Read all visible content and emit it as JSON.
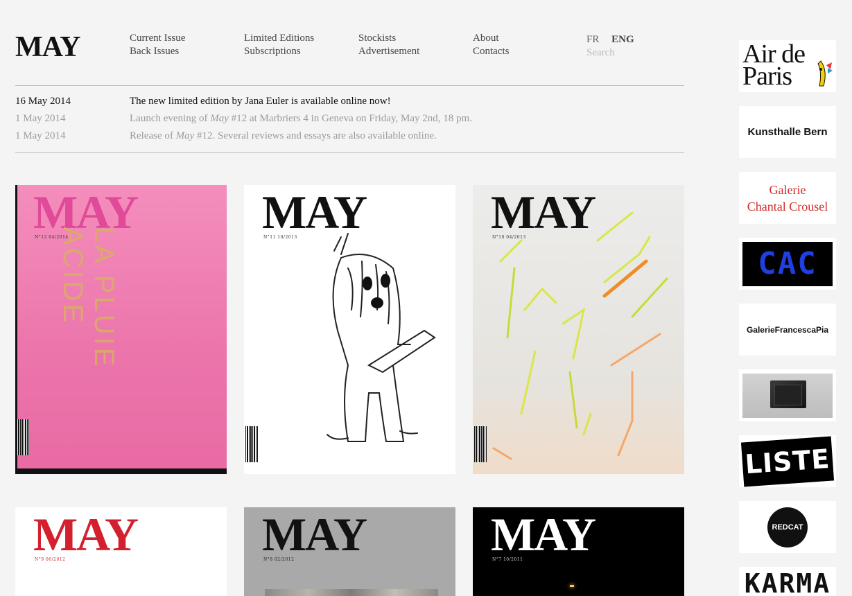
{
  "brand": {
    "logo": "MAY"
  },
  "nav": {
    "col1": [
      "Current Issue",
      "Back Issues"
    ],
    "col2": [
      "Limited Editions",
      "Subscriptions"
    ],
    "col3": [
      "Stockists",
      "Advertisement"
    ],
    "col4": [
      "About",
      "Contacts"
    ]
  },
  "lang": {
    "fr": "FR",
    "eng": "ENG"
  },
  "search": {
    "placeholder": "Search"
  },
  "news": [
    {
      "date": "16 May 2014",
      "text": "The new limited edition by Jana Euler is available online now!"
    },
    {
      "date": "1 May 2014",
      "text_before": "Launch evening of ",
      "text_em": "May",
      "text_after": " #12 at Marbriers 4 in Geneva on Friday, May 2nd, 18 pm."
    },
    {
      "date": "1 May 2014",
      "text_before": "Release of ",
      "text_em": "May",
      "text_after": " #12. Several reviews and essays are also available online."
    }
  ],
  "covers": [
    {
      "title": "MAY",
      "number": "N°12  04/2014",
      "cover_text": "LA PLUIE ACIDE",
      "bg": "#ef7fb2",
      "title_color": "#e04a98"
    },
    {
      "title": "MAY",
      "number": "N°11  10/2013",
      "bg": "#ffffff",
      "title_color": "#111111"
    },
    {
      "title": "MAY",
      "number": "N°10  04/2013",
      "bg": "#e8e6e2",
      "title_color": "#111111"
    },
    {
      "title": "MAY",
      "number": "N°9  06/2012",
      "bg": "#ffffff",
      "title_color": "#d4202e"
    },
    {
      "title": "MAY",
      "number": "N°8  02/2012",
      "bg": "#a9a9a9",
      "title_color": "#111111"
    },
    {
      "title": "MAY",
      "number": "N°7  10/2011",
      "bg": "#000000",
      "title_color": "#ffffff"
    }
  ],
  "ads": [
    {
      "name": "Air de Paris",
      "line1": "Air de",
      "line2": "Paris"
    },
    {
      "name": "Kunsthalle Bern",
      "label": "Kunsthalle Bern"
    },
    {
      "name": "Galerie Chantal Crousel",
      "line1": "Galerie",
      "line2": "Chantal Crousel"
    },
    {
      "name": "CAC",
      "label": "CAC"
    },
    {
      "name": "GalerieFrancescaPia",
      "label": "GalerieFrancescaPia"
    },
    {
      "name": "Box photo"
    },
    {
      "name": "LISTE",
      "label": "LISTE"
    },
    {
      "name": "REDCAT",
      "label": "REDCAT"
    },
    {
      "name": "KARMA",
      "label": "KARMA"
    }
  ]
}
